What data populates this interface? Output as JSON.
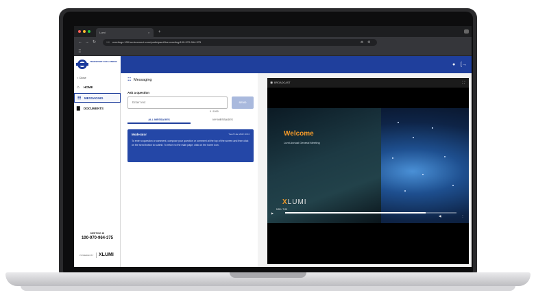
{
  "browser": {
    "tab_title": "Lumi",
    "tab_close": "×",
    "new_tab": "+",
    "url": "meetings.100.lumiconnect.com/participant/live-meeting/100-970-964-375",
    "back": "←",
    "forward": "→",
    "reload": "↻",
    "site_icon": "⊶",
    "ext_a": "⋒",
    "ext_b": "⚙",
    "apps": "⠿"
  },
  "header": {
    "logo_text": "TRANSPORT FOR LONDON",
    "help_icon_glyph": "●",
    "logout_icon_glyph": "[→"
  },
  "sidebar": {
    "close_label": "< Close",
    "items": [
      {
        "label": "HOME",
        "icon": "⌂"
      },
      {
        "label": "MESSAGING",
        "icon": "☷"
      },
      {
        "label": "DOCUMENTS",
        "icon": "▇"
      }
    ],
    "meeting_id_label": "MEETING ID",
    "meeting_id": "100-970-964-375",
    "powered_by": "POWERED BY",
    "lumi_brand": "LUMI",
    "lumi_x": "X"
  },
  "messaging": {
    "title": "Messaging",
    "title_icon": "☷",
    "ask_label": "Ask a question",
    "input_placeholder": "Enter text",
    "send_label": "SEND",
    "char_count": "0 / 1000",
    "tabs": [
      {
        "label": "ALL MESSAGES"
      },
      {
        "label": "MY MESSAGES"
      }
    ],
    "message": {
      "author": "Moderator",
      "time": "Tue 25 Jan 2022 10:34",
      "body": "To enter a question or comment, compose your question or comment at the top of the screen and then click on the send button to submit. To return to the main page, click on the home icon."
    }
  },
  "broadcast": {
    "label": "BROADCAST",
    "icon": "◉",
    "expand": "⛶",
    "welcome": "Welcome",
    "welcome_sub": "Lumi Annual General Meeting",
    "brand": "LUMI",
    "brand_x": "X",
    "time": "5:59 / 7:00",
    "progress": 0.82,
    "play": "▶",
    "volume": "◀)",
    "more": "⋮"
  }
}
